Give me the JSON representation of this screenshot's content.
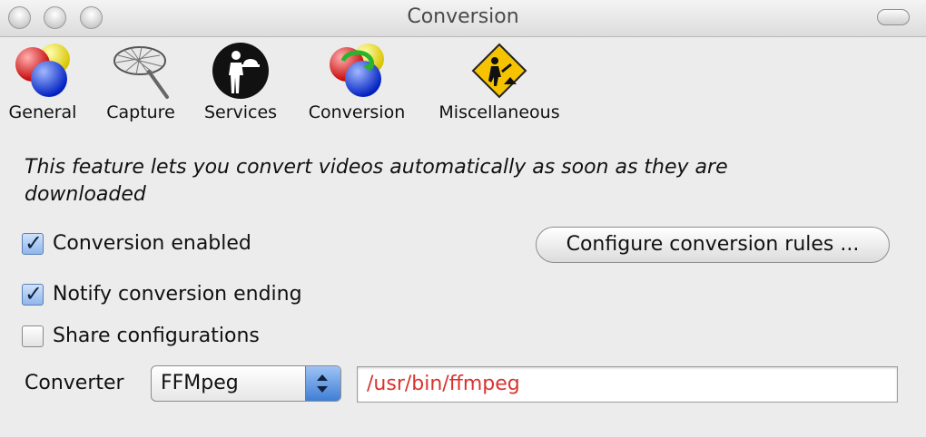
{
  "window": {
    "title": "Conversion"
  },
  "toolbar": {
    "items": [
      {
        "label": "General",
        "icon": "balls-icon"
      },
      {
        "label": "Capture",
        "icon": "net-icon"
      },
      {
        "label": "Services",
        "icon": "waiter-icon"
      },
      {
        "label": "Conversion",
        "icon": "conversion-balls-icon"
      },
      {
        "label": "Miscellaneous",
        "icon": "roadwork-sign-icon"
      }
    ]
  },
  "content": {
    "description": "This feature lets you convert videos automatically as soon as they are downloaded",
    "checkboxes": [
      {
        "label": "Conversion enabled",
        "checked": true
      },
      {
        "label": "Notify conversion ending",
        "checked": true
      },
      {
        "label": "Share configurations",
        "checked": false
      }
    ],
    "configure_button": "Configure conversion rules ...",
    "converter_label": "Converter",
    "converter_selected": "FFMpeg",
    "converter_path": "/usr/bin/ffmpeg"
  },
  "colors": {
    "path_text": "#d9332f",
    "select_accent": "#3f7ed6"
  }
}
